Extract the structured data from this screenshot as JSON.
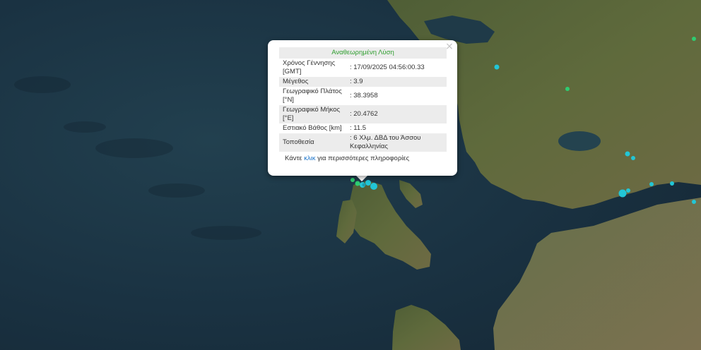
{
  "popup": {
    "title": "Αναθεωρημένη Λύση",
    "rows": [
      {
        "label": "Χρόνος Γέννησης [GMT]",
        "value": ": 17/09/2025 04:56:00.33"
      },
      {
        "label": "Μέγεθος",
        "value": ": 3.9"
      },
      {
        "label": "Γεωγραφικό Πλάτος [°N]",
        "value": ": 38.3958"
      },
      {
        "label": "Γεωγραφικό Μήκος [°E]",
        "value": ": 20.4762"
      },
      {
        "label": "Εστιακό Βάθος [km]",
        "value": ": 11.5"
      },
      {
        "label": "Τοποθεσία",
        "value": ": 6 Χλμ. ΔΒΔ του Άσσου Κεφαλληνίας"
      }
    ],
    "more_prefix": "Κάντε ",
    "more_link": "κλικ",
    "more_suffix": " για περισσότερες πληροφορίες",
    "close_icon": "close-icon"
  },
  "colors": {
    "sea": "#1b3343",
    "land": "#5c6a3a",
    "marker_cyan": "#22c6d6",
    "marker_green": "#2ecc71",
    "title_green": "#2f9e2f",
    "link_blue": "#1a73c9"
  }
}
